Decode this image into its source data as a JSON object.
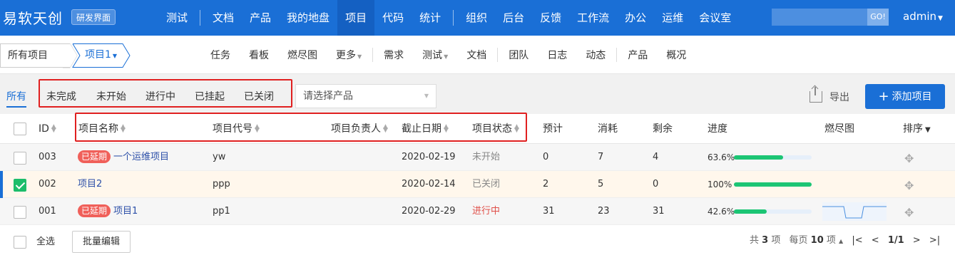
{
  "topnav": {
    "brand": "易软天创",
    "env_badge": "研发界面",
    "items": [
      {
        "label": "测试"
      },
      {
        "label": "文档"
      },
      {
        "label": "产品"
      },
      {
        "label": "我的地盘"
      },
      {
        "label": "项目",
        "active": true
      },
      {
        "label": "代码"
      },
      {
        "label": "统计"
      },
      {
        "label": "组织"
      },
      {
        "label": "后台"
      },
      {
        "label": "反馈"
      },
      {
        "label": "工作流"
      },
      {
        "label": "办公"
      },
      {
        "label": "运维"
      },
      {
        "label": "会议室"
      }
    ],
    "search_button": "GO!",
    "user": "admin"
  },
  "subnav": {
    "crumb_all": "所有项目",
    "crumb_project": "项目1",
    "items": [
      "任务",
      "看板",
      "燃尽图",
      "更多",
      "需求",
      "测试",
      "文档",
      "团队",
      "日志",
      "动态",
      "产品",
      "概况"
    ]
  },
  "filterbar": {
    "tabs": [
      "所有",
      "未完成",
      "未开始",
      "进行中",
      "已挂起",
      "已关闭"
    ],
    "product_placeholder": "请选择产品",
    "export_label": "导出",
    "add_label": "添加项目"
  },
  "table": {
    "headers": {
      "id": "ID",
      "name": "项目名称",
      "code": "项目代号",
      "owner": "项目负责人",
      "deadline": "截止日期",
      "status": "项目状态",
      "estimate": "预计",
      "consumed": "消耗",
      "left": "剩余",
      "progress": "进度",
      "burn": "燃尽图",
      "sort": "排序"
    },
    "rows": [
      {
        "id": "003",
        "delayed": "已延期",
        "name": "一个运维项目",
        "code": "yw",
        "deadline": "2020-02-19",
        "status": "未开始",
        "estimate": "0",
        "consumed": "7",
        "left": "4",
        "progress_text": "63.6%",
        "progress": 0.636,
        "checked": false
      },
      {
        "id": "002",
        "delayed": "",
        "name": "项目2",
        "code": "ppp",
        "deadline": "2020-02-14",
        "status": "已关闭",
        "estimate": "2",
        "consumed": "5",
        "left": "0",
        "progress_text": "100%",
        "progress": 1.0,
        "checked": true
      },
      {
        "id": "001",
        "delayed": "已延期",
        "name": "项目1",
        "code": "pp1",
        "deadline": "2020-02-29",
        "status": "进行中",
        "estimate": "31",
        "consumed": "23",
        "left": "31",
        "progress_text": "42.6%",
        "progress": 0.426,
        "checked": false
      }
    ],
    "footer": {
      "select_all": "全选",
      "batch_edit": "批量编辑",
      "total_prefix": "共",
      "total": "3",
      "total_suffix": "项",
      "per_page_prefix": "每页",
      "per_page": "10",
      "per_page_suffix": "项",
      "page": "1/1"
    }
  },
  "colors": {
    "primary": "#1a6fd6",
    "delay_badge": "#f0605a",
    "progress": "#1cc574",
    "highlight_box": "#e02020"
  }
}
